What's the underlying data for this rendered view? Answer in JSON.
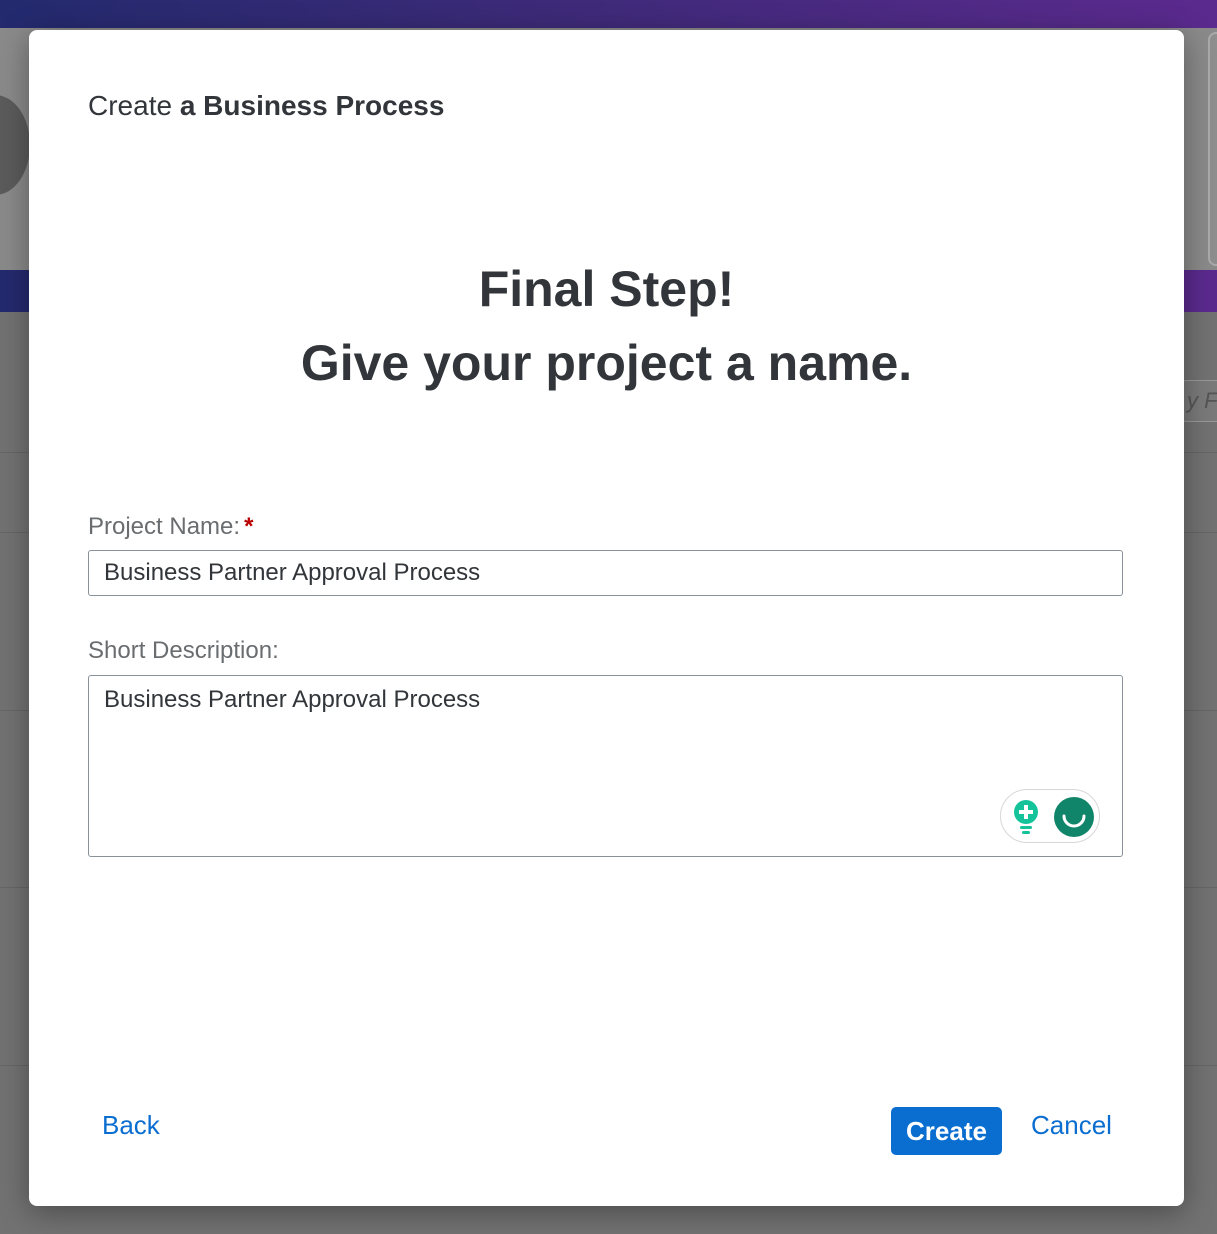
{
  "dialog": {
    "title_prefix": "Create",
    "title_strong": "a Business Process",
    "heading_line1": "Final Step!",
    "heading_line2": "Give your project a name."
  },
  "form": {
    "project_name": {
      "label": "Project Name:",
      "required_marker": "*",
      "value": "Business Partner Approval Process"
    },
    "short_description": {
      "label": "Short Description:",
      "value": "Business Partner Approval Process"
    },
    "assist_icons": [
      "lightbulb-icon",
      "grammar-assistant-icon"
    ]
  },
  "footer": {
    "back_label": "Back",
    "create_label": "Create",
    "cancel_label": "Cancel"
  },
  "colors": {
    "primary": "#0a6ed1",
    "required": "#bb0000",
    "text": "#32363a",
    "label": "#6a6d70",
    "assist_green": "#15c39a",
    "assist_dark_green": "#11856a"
  },
  "background": {
    "search_fragment": "y F"
  }
}
